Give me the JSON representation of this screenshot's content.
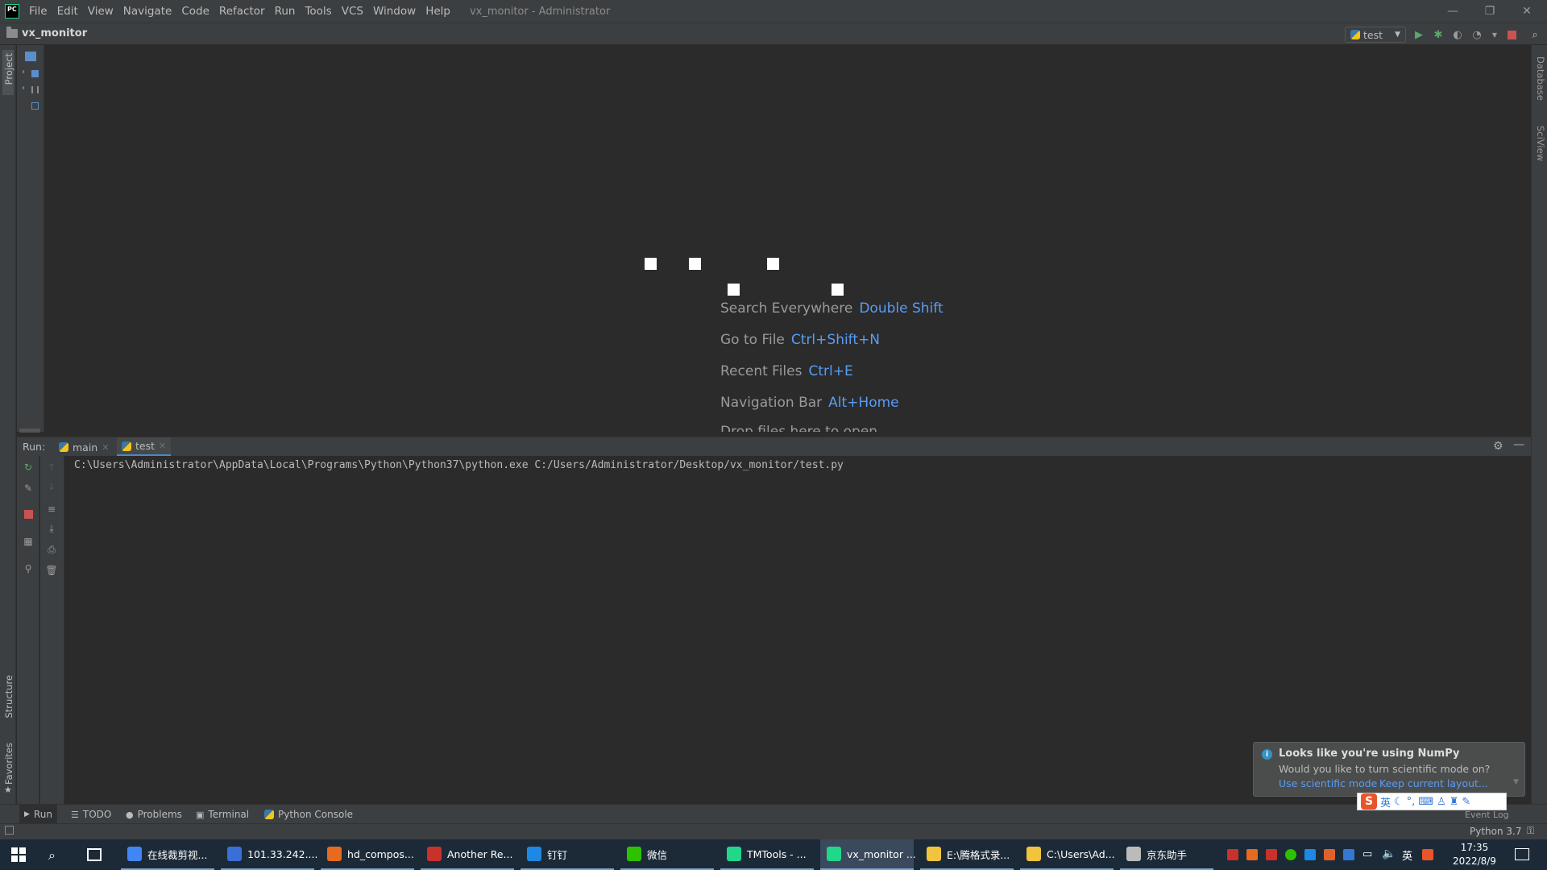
{
  "menu": {
    "items": [
      "File",
      "Edit",
      "View",
      "Navigate",
      "Code",
      "Refactor",
      "Run",
      "Tools",
      "VCS",
      "Window",
      "Help"
    ],
    "window_title": "vx_monitor - Administrator",
    "app_logo_text": "PC"
  },
  "navbar": {
    "project_name": "vx_monitor",
    "run_config": "test"
  },
  "left_stripe": {
    "project": "Project",
    "structure": "Structure",
    "favorites": "Favorites"
  },
  "right_stripe": {
    "database": "Database",
    "sciview": "SciView"
  },
  "editor": {
    "welcome": [
      {
        "action": "Search Everywhere",
        "shortcut": "Double Shift"
      },
      {
        "action": "Go to File",
        "shortcut": "Ctrl+Shift+N"
      },
      {
        "action": "Recent Files",
        "shortcut": "Ctrl+E"
      },
      {
        "action": "Navigation Bar",
        "shortcut": "Alt+Home"
      },
      {
        "action": "Drop files here to open",
        "shortcut": ""
      }
    ]
  },
  "run_panel": {
    "label": "Run:",
    "tabs": [
      {
        "label": "main",
        "active": false
      },
      {
        "label": "test",
        "active": true
      }
    ],
    "console_output": "C:\\Users\\Administrator\\AppData\\Local\\Programs\\Python\\Python37\\python.exe C:/Users/Administrator/Desktop/vx_monitor/test.py"
  },
  "bottom_tools": [
    {
      "label": "Run",
      "active": true
    },
    {
      "label": "TODO",
      "active": false
    },
    {
      "label": "Problems",
      "active": false
    },
    {
      "label": "Terminal",
      "active": false
    },
    {
      "label": "Python Console",
      "active": false
    }
  ],
  "status_bar": {
    "event_log": "Event Log",
    "interpreter": "Python 3.7"
  },
  "notification": {
    "title": "Looks like you're using NumPy",
    "body": "Would you like to turn scientific mode on?",
    "link_primary": "Use scientific mode",
    "link_secondary": "Keep current layout..."
  },
  "ime": {
    "mode": "英"
  },
  "taskbar": {
    "apps": [
      {
        "label": "在线裁剪视...",
        "color": "#4285f4"
      },
      {
        "label": "101.33.242....",
        "color": "#3a6fd8"
      },
      {
        "label": "hd_compos...",
        "color": "#e66a1f"
      },
      {
        "label": "Another Re...",
        "color": "#c8322b"
      },
      {
        "label": "钉钉",
        "color": "#1e88e5"
      },
      {
        "label": "微信",
        "color": "#2dc100"
      },
      {
        "label": "TMTools - ...",
        "color": "#21d789"
      },
      {
        "label": "vx_monitor ...",
        "color": "#21d789"
      },
      {
        "label": "E:\\腾格式录...",
        "color": "#f0c43c"
      },
      {
        "label": "C:\\Users\\Ad...",
        "color": "#f0c43c"
      },
      {
        "label": "京东助手",
        "color": "#bbbbbb"
      }
    ],
    "active_index": 7,
    "tray_lang": "英",
    "time": "17:35",
    "date": "2022/8/9"
  }
}
